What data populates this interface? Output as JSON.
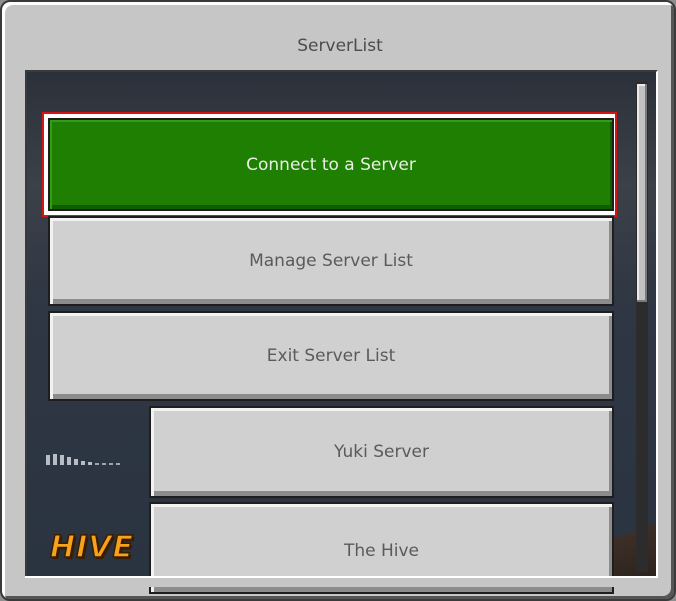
{
  "window": {
    "title": "ServerList"
  },
  "buttons": {
    "connect": "Connect to a Server",
    "manage": "Manage Server List",
    "exit": "Exit Server List"
  },
  "servers": [
    {
      "name": "Yuki Server",
      "icon": "signal-strength-icon"
    },
    {
      "name": "The Hive",
      "icon": "hive-logo",
      "logo_text": "HIVE"
    }
  ],
  "colors": {
    "primary_button": "#1f7f03",
    "focus_outline": "#d31515",
    "button_face": "#d0d0d0",
    "panel_bg": "#c6c6c6"
  }
}
